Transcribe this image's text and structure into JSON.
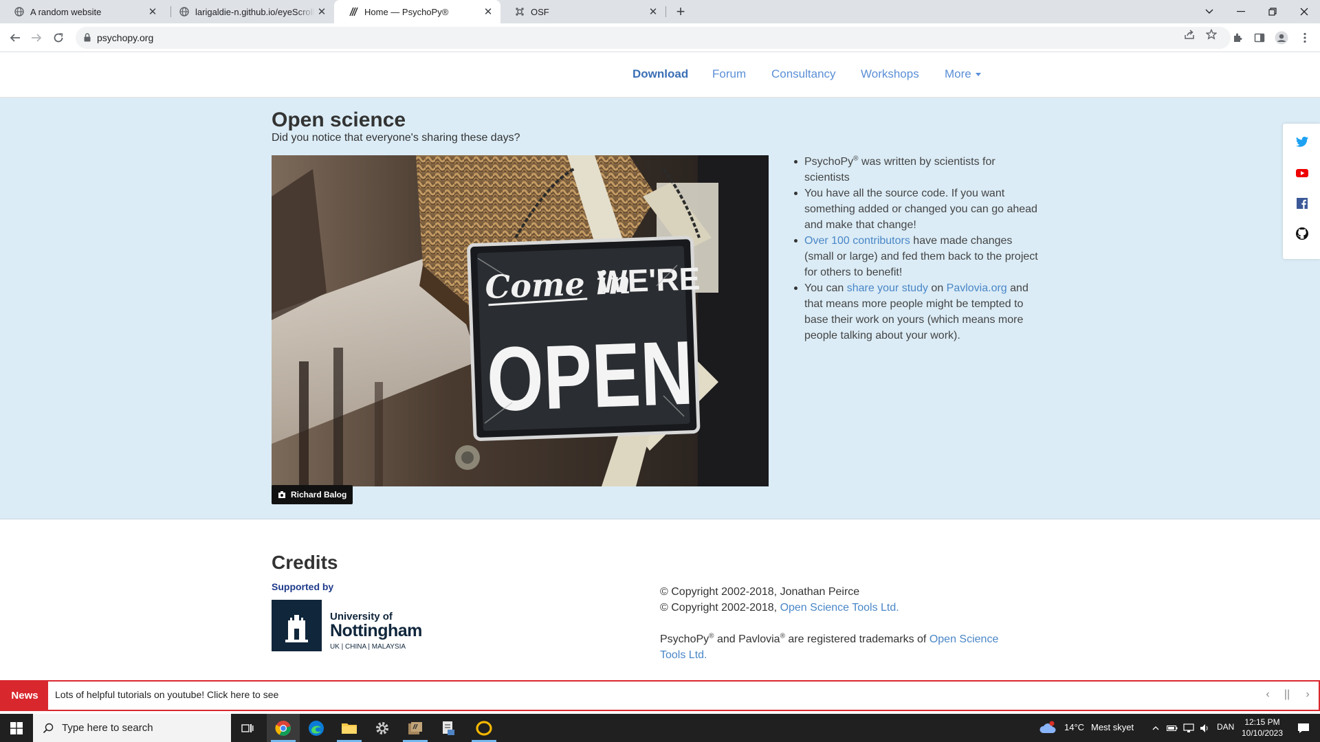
{
  "browser": {
    "tabs": [
      {
        "title": "A random website",
        "active": false
      },
      {
        "title": "larigaldie-n.github.io/eyeScrollR",
        "active": false
      },
      {
        "title": "Home — PsychoPy®",
        "active": true
      },
      {
        "title": "OSF",
        "active": false
      }
    ],
    "url": "psychopy.org"
  },
  "nav": {
    "download": "Download",
    "forum": "Forum",
    "consultancy": "Consultancy",
    "workshops": "Workshops",
    "more": "More"
  },
  "open_science": {
    "heading": "Open science",
    "subheading": "Did you notice that everyone's sharing these days?",
    "photo_credit": "Richard Balog",
    "photo_sign": {
      "line1": "Come in",
      "line2": "WE'RE",
      "line3": "OPEN"
    },
    "bullets": {
      "b1_a": "PsychoPy",
      "b1_reg": "®",
      "b1_b": " was written by scientists for scientists",
      "b2": "You have all the source code. If you want something added or changed you can go ahead and make that change!",
      "b3_link": "Over 100 contributors",
      "b3_rest": " have made changes (small or large) and fed them back to the project for others to benefit!",
      "b4_a": "You can ",
      "b4_link1": "share your study",
      "b4_b": " on ",
      "b4_link2": "Pavlovia.org",
      "b4_c": " and that means more people might be tempted to base their work on yours (which means more people talking about your work)."
    }
  },
  "social": [
    "twitter-icon",
    "youtube-icon",
    "facebook-icon",
    "github-icon"
  ],
  "credits": {
    "heading": "Credits",
    "supported_by": "Supported by",
    "logo": {
      "line1": "University of",
      "line2": "Nottingham",
      "line3": "UK | CHINA | MALAYSIA"
    },
    "copyright1": "© Copyright 2002-2018, Jonathan Peirce",
    "copyright2_a": "© Copyright 2002-2018, ",
    "copyright2_link": "Open Science Tools Ltd.",
    "tm_a": "PsychoPy",
    "tm_reg1": "®",
    "tm_b": " and Pavlovia",
    "tm_reg2": "®",
    "tm_c": " are registered trademarks of ",
    "tm_link": "Open Science Tools Ltd."
  },
  "news": {
    "label": "News",
    "text": "Lots of helpful tutorials on youtube! Click here to see"
  },
  "taskbar": {
    "search_placeholder": "Type here to search",
    "weather_temp": "14°C",
    "weather_desc": "Mest skyet",
    "weather_badge": "1",
    "lang": "DAN",
    "time": "12:15 PM",
    "date": "10/10/2023",
    "notif_count": "1"
  },
  "colors": {
    "accent": "#5a8fd6",
    "band": "#dbecf6",
    "news_red": "#d9272e"
  }
}
